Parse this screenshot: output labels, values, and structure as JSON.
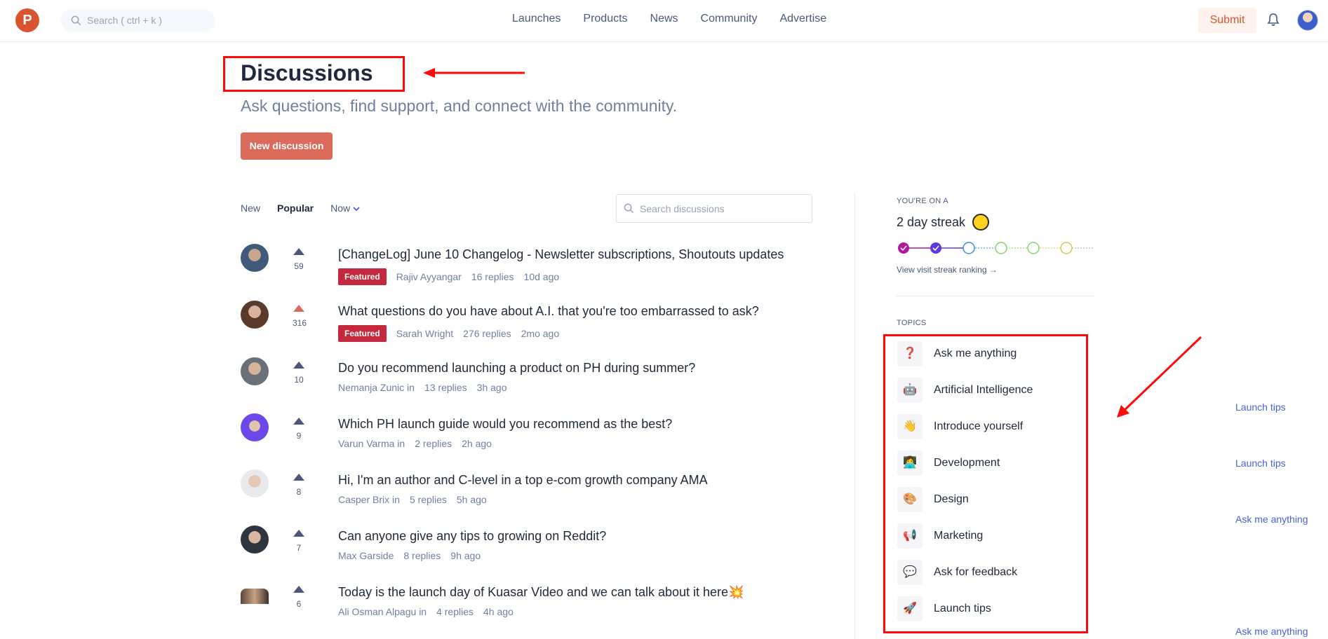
{
  "header": {
    "logo_letter": "P",
    "search_placeholder": "Search ( ctrl + k )",
    "nav": [
      "Launches",
      "Products",
      "News",
      "Community",
      "Advertise"
    ],
    "submit_label": "Submit"
  },
  "page": {
    "title": "Discussions",
    "subtitle": "Ask questions, find support, and connect with the community.",
    "new_button": "New discussion"
  },
  "filters": {
    "new": "New",
    "popular": "Popular",
    "now": "Now",
    "search_placeholder": "Search discussions"
  },
  "discussions": [
    {
      "votes": "59",
      "title": "[ChangeLog] June 10 Changelog - Newsletter subscriptions, Shoutouts updates",
      "badge": "Featured",
      "author": "Rajiv Ayyangar",
      "in": "",
      "topic": "",
      "replies": "16 replies",
      "time": "10d ago"
    },
    {
      "votes": "316",
      "title": "What questions do you have about A.I. that you're too embarrassed to ask?",
      "badge": "Featured",
      "author": "Sarah Wright",
      "in": "",
      "topic": "",
      "replies": "276 replies",
      "time": "2mo ago"
    },
    {
      "votes": "10",
      "title": "Do you recommend launching a product on PH during summer?",
      "badge": "",
      "author": "Nemanja Zunic",
      "in": "in",
      "topic": "Launch tips",
      "replies": "13 replies",
      "time": "3h ago"
    },
    {
      "votes": "9",
      "title": "Which PH launch guide would you recommend as the best?",
      "badge": "",
      "author": "Varun Varma",
      "in": "in",
      "topic": "Launch tips",
      "replies": "2 replies",
      "time": "2h ago"
    },
    {
      "votes": "8",
      "title": "Hi, I'm an author and C-level in a top e-com growth company AMA",
      "badge": "",
      "author": "Casper Brix",
      "in": "in",
      "topic": "Ask me anything",
      "replies": "5 replies",
      "time": "5h ago"
    },
    {
      "votes": "7",
      "title": "Can anyone give any tips to growing on Reddit?",
      "badge": "",
      "author": "Max Garside",
      "in": "",
      "topic": "",
      "replies": "8 replies",
      "time": "9h ago"
    },
    {
      "votes": "6",
      "title": "Today is the launch day of Kuasar Video and we can talk about it here💥",
      "badge": "",
      "author": "Ali Osman Alpagu",
      "in": "in",
      "topic": "Ask me anything",
      "replies": "4 replies",
      "time": "4h ago"
    }
  ],
  "sidebar": {
    "streak_label": "YOU'RE ON A",
    "streak_title": "2 day streak",
    "ranking_link": "View visit streak ranking →",
    "topics_label": "TOPICS",
    "topics": [
      {
        "icon": "❓",
        "label": "Ask me anything"
      },
      {
        "icon": "🤖",
        "label": "Artificial Intelligence"
      },
      {
        "icon": "👋",
        "label": "Introduce yourself"
      },
      {
        "icon": "👩‍💻",
        "label": "Development"
      },
      {
        "icon": "🎨",
        "label": "Design"
      },
      {
        "icon": "📢",
        "label": "Marketing"
      },
      {
        "icon": "💬",
        "label": "Ask for feedback"
      },
      {
        "icon": "🚀",
        "label": "Launch tips"
      }
    ]
  },
  "colors": {
    "brand": "#da552f",
    "annotation_red": "#ff0a0a",
    "featured_badge": "#c5283d",
    "topic_link": "#4b5fd8"
  }
}
